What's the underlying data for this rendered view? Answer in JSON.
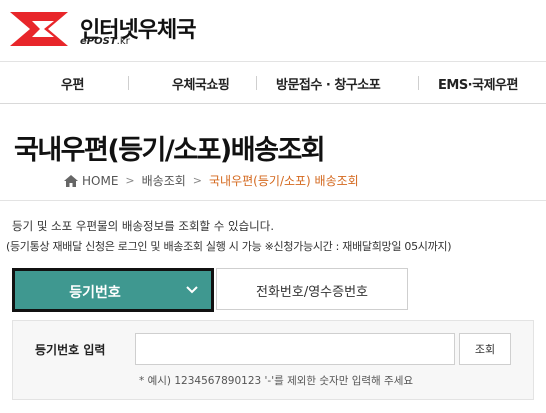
{
  "header": {
    "logo_text": "인터넷우체국",
    "logo_sub_en": "ePOST",
    "logo_sub_kr": ".kr"
  },
  "gnb": {
    "items": [
      {
        "label": "우편"
      },
      {
        "label": "우체국쇼핑"
      },
      {
        "label": "방문접수 · 창구소포"
      },
      {
        "label": "EMS·국제우편"
      }
    ]
  },
  "page": {
    "title": "국내우편(등기/소포)배송조회"
  },
  "breadcrumb": {
    "home": "HOME",
    "level1": "배송조회",
    "current": "국내우편(등기/소포) 배송조회"
  },
  "description": {
    "line1": "등기 및 소포 우편물의 배송정보를 조회할 수 있습니다.",
    "line2": "(등기통상 재배달 신청은 로그인 및 배송조회 실행 시 가능 ※신청가능시간 : 재배달희망일 05시까지)"
  },
  "tabs": {
    "active_label": "등기번호",
    "inactive_label": "전화번호/영수증번호"
  },
  "form": {
    "field_label": "등기번호 입력",
    "input_value": "",
    "search_label": "조회",
    "hint": "* 예시) 1234567890123 '-'를 제외한 숫자만 입력해 주세요"
  },
  "colors": {
    "brand_red": "#e8262a",
    "tab_active": "#3f9890",
    "breadcrumb_current": "#d4691f"
  }
}
